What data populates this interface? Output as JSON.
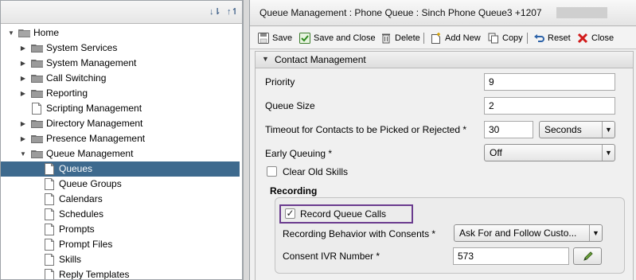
{
  "tree": {
    "items": [
      {
        "label": "Home",
        "expanded": true
      },
      {
        "label": "System Services"
      },
      {
        "label": "System Management"
      },
      {
        "label": "Call Switching"
      },
      {
        "label": "Reporting"
      },
      {
        "label": "Scripting Management"
      },
      {
        "label": "Directory Management"
      },
      {
        "label": "Presence Management"
      },
      {
        "label": "Queue Management",
        "expanded": true
      },
      {
        "label": "Queues",
        "selected": true
      },
      {
        "label": "Queue Groups"
      },
      {
        "label": "Calendars"
      },
      {
        "label": "Schedules"
      },
      {
        "label": "Prompts"
      },
      {
        "label": "Prompt Files"
      },
      {
        "label": "Skills"
      },
      {
        "label": "Reply Templates"
      }
    ]
  },
  "header": {
    "title": "Queue Management : Phone Queue : Sinch Phone Queue3 +1207"
  },
  "actions": {
    "save": "Save",
    "save_close": "Save and Close",
    "delete": "Delete",
    "add_new": "Add New",
    "copy": "Copy",
    "reset": "Reset",
    "close": "Close"
  },
  "section": {
    "title": "Contact Management"
  },
  "form": {
    "priority": {
      "label": "Priority",
      "value": "9"
    },
    "queue_size": {
      "label": "Queue Size",
      "value": "2"
    },
    "timeout": {
      "label": "Timeout for Contacts to be Picked or Rejected *",
      "value": "30",
      "unit": "Seconds"
    },
    "early_queuing": {
      "label": "Early Queuing *",
      "value": "Off"
    },
    "clear_old_skills": {
      "label": "Clear Old Skills",
      "checked": false
    },
    "recording": {
      "group_label": "Recording",
      "record_queue_calls": {
        "label": "Record Queue Calls",
        "checked": true
      },
      "behavior": {
        "label": "Recording Behavior with Consents *",
        "value": "Ask For and Follow Custo..."
      },
      "consent_ivr": {
        "label": "Consent IVR Number *",
        "value": "573"
      }
    }
  },
  "colors": {
    "selection": "#3e6a8e",
    "highlight_border": "#6a3b8e"
  }
}
